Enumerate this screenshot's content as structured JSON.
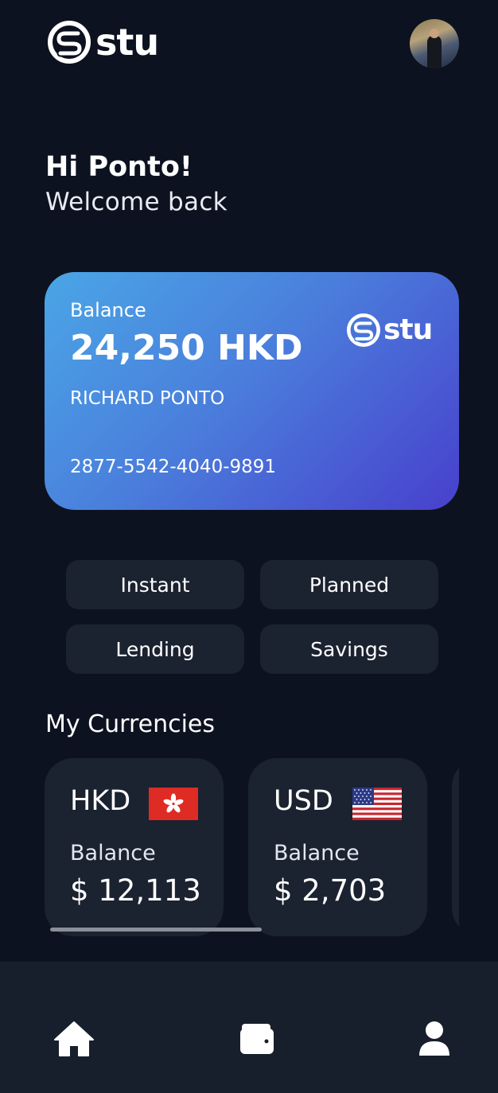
{
  "header": {
    "logo_text": "stu",
    "avatar_icon": "user-photo-avatar"
  },
  "greeting": {
    "title": "Hi Ponto!",
    "subtitle": "Welcome back"
  },
  "card": {
    "balance_label": "Balance",
    "balance_amount": "24,250 HKD",
    "holder_name": "RICHARD PONTO",
    "card_number": "2877-5542-4040-9891",
    "logo_text": "stu",
    "gradient_start": "#4aa6e6",
    "gradient_end": "#4840cc"
  },
  "actions": [
    {
      "label": "Instant"
    },
    {
      "label": "Planned"
    },
    {
      "label": "Lending"
    },
    {
      "label": "Savings"
    }
  ],
  "currencies": {
    "title": "My Currencies",
    "items": [
      {
        "code": "HKD",
        "flag": "hong-kong-flag",
        "balance_label": "Balance",
        "balance_value": "$ 12,113"
      },
      {
        "code": "USD",
        "flag": "us-flag",
        "balance_label": "Balance",
        "balance_value": "$ 2,703"
      }
    ]
  },
  "bottom_nav": [
    {
      "icon": "home-icon"
    },
    {
      "icon": "wallet-icon"
    },
    {
      "icon": "user-icon"
    }
  ],
  "colors": {
    "background": "#0d1220",
    "surface": "#1b2230",
    "nav_background": "#181f2c"
  }
}
